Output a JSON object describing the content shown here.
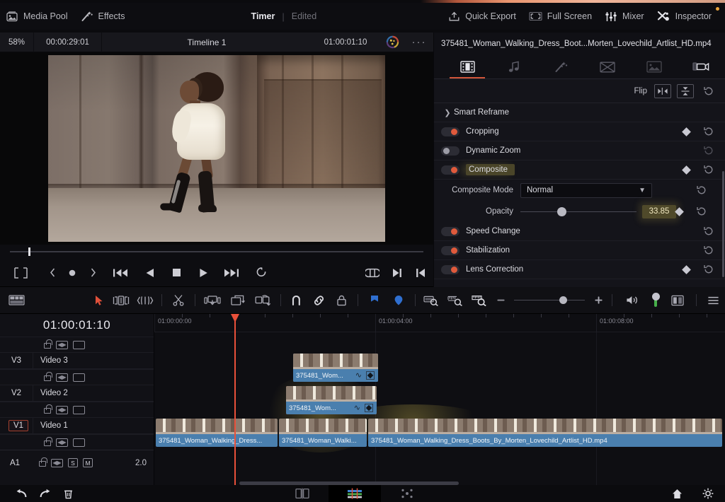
{
  "topbar": {
    "left_items": [
      {
        "label": "Media Pool",
        "icon": "media-pool-icon"
      },
      {
        "label": "Effects",
        "icon": "effects-wand-icon"
      }
    ],
    "center_mode_active": "Timer",
    "center_mode_inactive": "Edited",
    "right_items": [
      {
        "label": "Quick Export",
        "icon": "quick-export-icon"
      },
      {
        "label": "Full Screen",
        "icon": "full-screen-icon"
      },
      {
        "label": "Mixer",
        "icon": "mixer-icon"
      },
      {
        "label": "Inspector",
        "icon": "inspector-icon"
      }
    ]
  },
  "viewer": {
    "zoom": "58%",
    "duration": "00:00:29:01",
    "title": "Timeline 1",
    "timecode": "01:00:01:10",
    "color_icon": "color-wheel-icon",
    "more_label": "···"
  },
  "inspector": {
    "clip_name": "375481_Woman_Walking_Dress_Boot...Morten_Lovechild_Artlist_HD.mp4",
    "tabs": [
      {
        "name": "video",
        "icon": "film-strip-icon",
        "active": true
      },
      {
        "name": "audio",
        "icon": "music-note-icon",
        "active": false
      },
      {
        "name": "effects",
        "icon": "magic-wand-icon",
        "active": false
      },
      {
        "name": "transition",
        "icon": "bowtie-transition-icon",
        "active": false
      },
      {
        "name": "image",
        "icon": "image-icon",
        "active": false
      },
      {
        "name": "file",
        "icon": "camera-file-icon",
        "active": false
      }
    ],
    "flip": {
      "label": "Flip",
      "horizontal_icon": "flip-horizontal-icon",
      "vertical_icon": "flip-vertical-icon"
    },
    "smart_reframe": {
      "label": "Smart Reframe",
      "expanded": false
    },
    "sections": [
      {
        "label": "Cropping",
        "enabled": true,
        "keyframe": true
      },
      {
        "label": "Dynamic Zoom",
        "enabled": false,
        "keyframe": false
      },
      {
        "label": "Composite",
        "enabled": true,
        "keyframe": true,
        "highlighted": true
      },
      {
        "label": "Speed Change",
        "enabled": true,
        "keyframe": false
      },
      {
        "label": "Stabilization",
        "enabled": true,
        "keyframe": false
      },
      {
        "label": "Lens Correction",
        "enabled": true,
        "keyframe": true
      }
    ],
    "composite_mode": {
      "label": "Composite Mode",
      "value": "Normal"
    },
    "opacity": {
      "label": "Opacity",
      "value": "33.85",
      "slider_percent": 34,
      "highlighted": true
    }
  },
  "transport": {
    "buttons": [
      {
        "name": "viewer-mode-button",
        "icon": "frame-crop-icon"
      },
      {
        "name": "prev-keyframe-button",
        "icon": "chevron-left-icon"
      },
      {
        "name": "keyframe-button",
        "icon": "dot-icon"
      },
      {
        "name": "next-keyframe-button",
        "icon": "chevron-right-icon"
      },
      {
        "name": "jump-start-button",
        "icon": "skip-back-icon"
      },
      {
        "name": "play-reverse-button",
        "icon": "play-reverse-icon"
      },
      {
        "name": "stop-button",
        "icon": "stop-icon"
      },
      {
        "name": "play-forward-button",
        "icon": "play-icon"
      },
      {
        "name": "jump-end-button",
        "icon": "skip-forward-icon"
      },
      {
        "name": "loop-button",
        "icon": "loop-icon"
      },
      {
        "name": "inout-range-button",
        "icon": "in-out-range-icon"
      },
      {
        "name": "mark-out-button",
        "icon": "mark-out-icon"
      },
      {
        "name": "mark-in-button",
        "icon": "mark-in-icon"
      }
    ]
  },
  "timeline_toolbar": {
    "tools": [
      {
        "name": "timeline-view-options",
        "icon": "timeline-view-icon",
        "active": false
      },
      {
        "name": "selection-tool",
        "icon": "arrow-pointer-icon",
        "active": true
      },
      {
        "name": "trim-edit-tool",
        "icon": "trim-edit-icon",
        "active": false
      },
      {
        "name": "dynamic-trim-tool",
        "icon": "dynamic-trim-icon",
        "active": false
      },
      {
        "name": "blade-tool",
        "icon": "scissors-icon",
        "active": false
      },
      {
        "name": "insert-clip-button",
        "icon": "insert-clip-icon",
        "active": false
      },
      {
        "name": "overwrite-clip-button",
        "icon": "overwrite-clip-icon",
        "active": false
      },
      {
        "name": "replace-clip-button",
        "icon": "replace-clip-icon",
        "active": false
      },
      {
        "name": "snapping-toggle",
        "icon": "magnet-icon",
        "active": false
      },
      {
        "name": "linked-selection-toggle",
        "icon": "link-icon",
        "active": false
      },
      {
        "name": "lock-tracks-toggle",
        "icon": "padlock-icon",
        "active": false
      },
      {
        "name": "flag-button",
        "icon": "flag-icon",
        "active": false
      },
      {
        "name": "marker-button",
        "icon": "marker-icon",
        "active": false
      },
      {
        "name": "fit-timeline-button",
        "icon": "zoom-fit-icon",
        "active": false
      },
      {
        "name": "detail-zoom-button",
        "icon": "zoom-detail-icon",
        "active": false
      },
      {
        "name": "custom-zoom-button",
        "icon": "zoom-custom-icon",
        "active": false
      },
      {
        "name": "zoom-out-button",
        "icon": "minus-icon",
        "active": false
      },
      {
        "name": "zoom-in-button",
        "icon": "plus-icon",
        "active": false
      },
      {
        "name": "audio-mute-button",
        "icon": "speaker-icon",
        "active": false
      },
      {
        "name": "audio-level-meter",
        "icon": "audio-level-icon",
        "active": false
      },
      {
        "name": "split-view-button",
        "icon": "split-view-icon",
        "active": false
      },
      {
        "name": "options-menu-button",
        "icon": "hamburger-icon",
        "active": false
      }
    ]
  },
  "timeline": {
    "timecode": "01:00:01:10",
    "ruler_labels": [
      "01:00:00:00",
      "01:00:04:00",
      "01:00:08:00"
    ],
    "track_control_icons": [
      "lock-icon",
      "auto-select-icon",
      "video-enable-icon"
    ],
    "tracks": [
      {
        "id": "V3",
        "name": "Video 3",
        "active": false
      },
      {
        "id": "V2",
        "name": "Video 2",
        "active": false
      },
      {
        "id": "V1",
        "name": "Video 1",
        "active": true
      }
    ],
    "audio_track": {
      "id": "A1",
      "level": "2.0",
      "controls": [
        "lock-icon",
        "auto-select-icon",
        "solo-icon",
        "mute-icon"
      ],
      "solo_label": "S",
      "mute_label": "M"
    },
    "clips": {
      "v3": [
        {
          "label": "375481_Wom...",
          "selected": false
        }
      ],
      "v2": [
        {
          "label": "375481_Wom...",
          "selected": true
        }
      ],
      "v1": [
        {
          "label": "375481_Woman_Walking_Dress...",
          "selected": false
        },
        {
          "label": "375481_Woman_Walki...",
          "selected": false
        },
        {
          "label": "375481_Woman_Walking_Dress_Boots_By_Morten_Lovechild_Artlist_HD.mp4",
          "selected": false
        }
      ]
    }
  },
  "bottombar": {
    "left": [
      {
        "name": "undo-button",
        "icon": "undo-arrow-icon"
      },
      {
        "name": "redo-button",
        "icon": "redo-arrow-icon"
      },
      {
        "name": "delete-button",
        "icon": "trash-icon"
      }
    ],
    "pages": [
      {
        "name": "cut-page",
        "icon": "cut-page-icon",
        "active": false
      },
      {
        "name": "edit-page",
        "icon": "edit-page-icon",
        "active": true
      },
      {
        "name": "fusion-page",
        "icon": "fusion-page-icon",
        "active": false
      }
    ],
    "right": [
      {
        "name": "home-button",
        "icon": "home-icon"
      },
      {
        "name": "project-settings-button",
        "icon": "gear-icon"
      }
    ]
  },
  "colors": {
    "accent_red": "#d2553a",
    "toggle_on": "#e05a3c",
    "clip_blue": "#4a7fae",
    "playhead": "#e8503a",
    "highlight_olive": "#968a3e"
  }
}
